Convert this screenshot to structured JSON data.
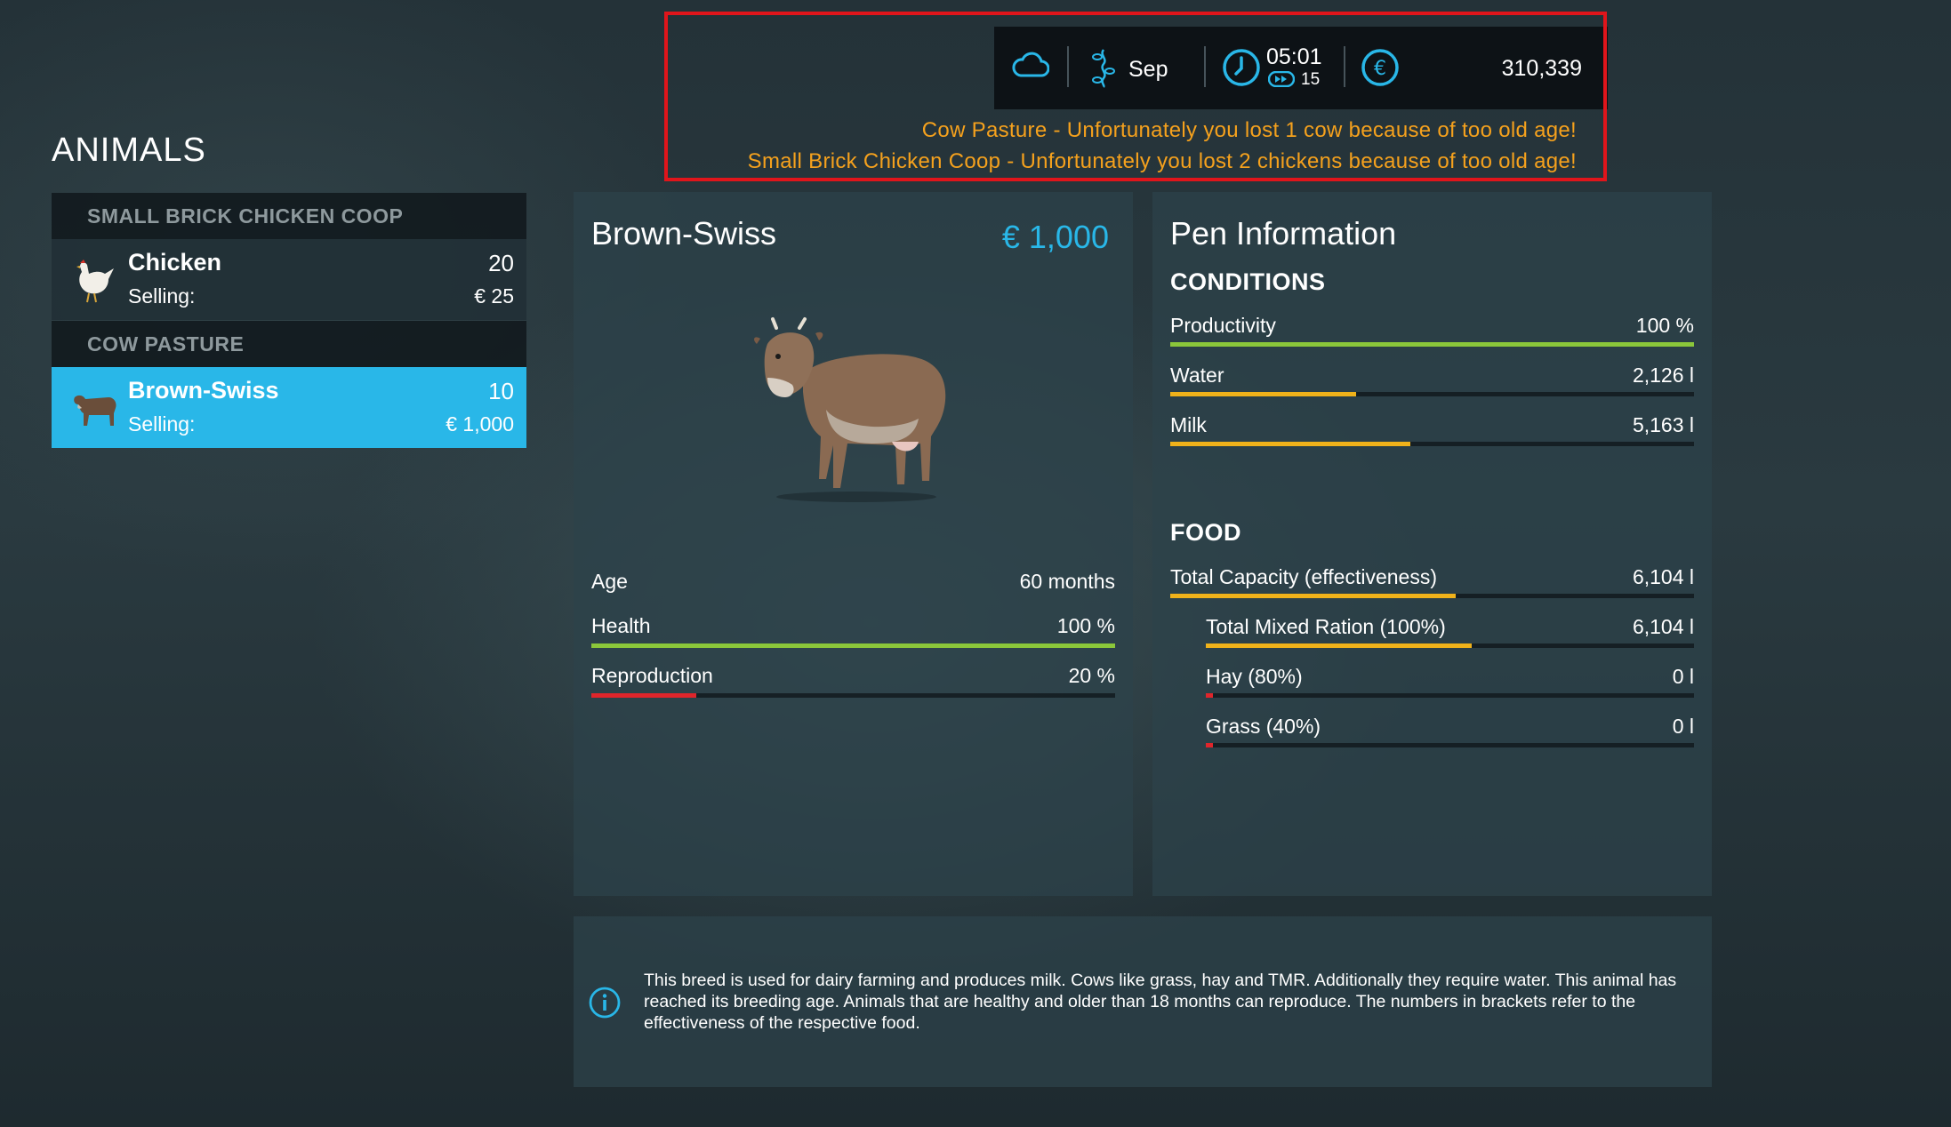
{
  "hud": {
    "month": "Sep",
    "time": "05:01",
    "time_speed": "15",
    "money": "310,339",
    "weather_icon": "cloud-icon",
    "season_icon": "season-icon",
    "clock_icon": "clock-icon",
    "currency_icon": "euro-icon"
  },
  "notifications": [
    "Cow Pasture - Unfortunately you lost 1 cow because of too old age!",
    "Small Brick Chicken Coop - Unfortunately you lost 2 chickens because of too old age!"
  ],
  "screen_title": "ANIMALS",
  "groups": [
    {
      "title": "SMALL BRICK CHICKEN COOP",
      "items": [
        {
          "name": "Chicken",
          "count": "20",
          "selling_label": "Selling:",
          "price": "€ 25",
          "icon": "chicken-icon",
          "selected": false
        }
      ]
    },
    {
      "title": "COW PASTURE",
      "items": [
        {
          "name": "Brown-Swiss",
          "count": "10",
          "selling_label": "Selling:",
          "price": "€ 1,000",
          "icon": "cow-icon",
          "selected": true
        }
      ]
    }
  ],
  "animal": {
    "name": "Brown-Swiss",
    "price": "€ 1,000",
    "image": "cow-image",
    "stats": [
      {
        "label": "Age",
        "value": "60 months"
      },
      {
        "label": "Health",
        "value": "100 %",
        "fraction": 1.0,
        "color": "#8bc73a"
      },
      {
        "label": "Reproduction",
        "value": "20 %",
        "fraction": 0.2,
        "color": "#e0252b"
      }
    ]
  },
  "pen": {
    "title": "Pen Information",
    "conditions_title": "CONDITIONS",
    "conditions": [
      {
        "label": "Productivity",
        "value": "100 %",
        "fraction": 1.0,
        "color": "#8bc73a"
      },
      {
        "label": "Water",
        "value": "2,126 l",
        "fraction": 0.355,
        "color": "#f0b21a"
      },
      {
        "label": "Milk",
        "value": "5,163 l",
        "fraction": 0.458,
        "color": "#f0b21a"
      }
    ],
    "food_title": "FOOD",
    "food": [
      {
        "label": "Total Capacity (effectiveness)",
        "value": "6,104 l",
        "fraction": 0.545,
        "color": "#f0b21a",
        "indent": false
      },
      {
        "label": "Total Mixed Ration (100%)",
        "value": "6,104 l",
        "fraction": 0.545,
        "color": "#f0b21a",
        "indent": true
      },
      {
        "label": "Hay (80%)",
        "value": "0 l",
        "fraction": 0.015,
        "color": "#e0252b",
        "indent": true
      },
      {
        "label": "Grass (40%)",
        "value": "0 l",
        "fraction": 0.015,
        "color": "#e0252b",
        "indent": true
      }
    ]
  },
  "info": {
    "icon": "info-icon",
    "text": "This breed is used for dairy farming and produces milk. Cows like grass, hay and TMR. Additionally they require water. This animal has reached its breeding age. Animals that are healthy and older than 18 months can reproduce. The numbers in brackets refer to the effectiveness of the respective food."
  },
  "colors": {
    "accent": "#29b7e8",
    "notification": "#f5a11d",
    "highlight_outline": "#e0151b"
  }
}
